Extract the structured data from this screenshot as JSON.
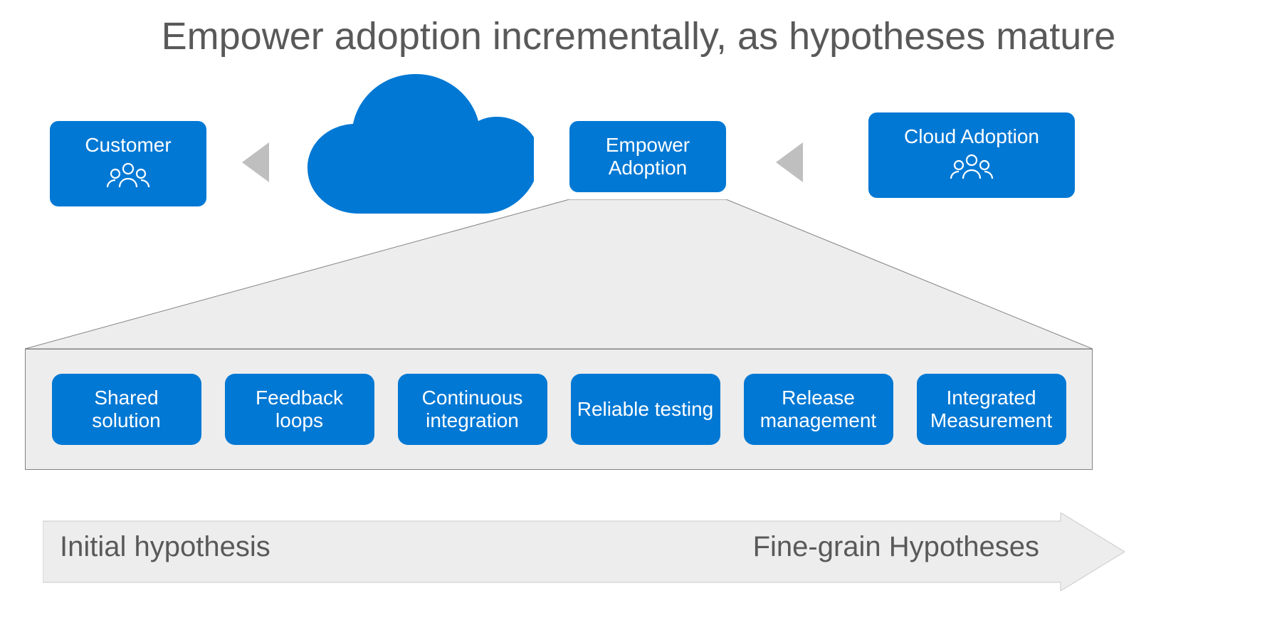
{
  "title": "Empower adoption incrementally, as hypotheses mature",
  "flow": {
    "customer": "Customer",
    "empower": "Empower\nAdoption",
    "cloud": "Cloud Adoption"
  },
  "details": [
    "Shared solution",
    "Feedback loops",
    "Continuous integration",
    "Reliable testing",
    "Release management",
    "Integrated Measurement"
  ],
  "spectrum": {
    "left": "Initial hypothesis",
    "right": "Fine-grain Hypotheses"
  },
  "colors": {
    "brand": "#0078d4",
    "grayText": "#595959",
    "panel": "#ededed",
    "border": "#828282",
    "arrowGray": "#bfbfbf"
  }
}
